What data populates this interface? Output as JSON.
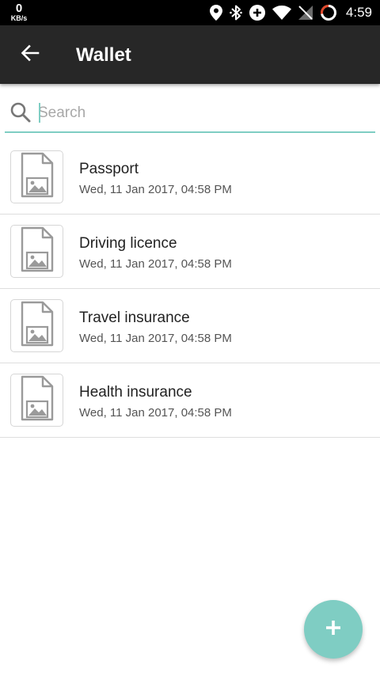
{
  "status_bar": {
    "net_speed_value": "0",
    "net_speed_unit": "KB/s",
    "time": "4:59",
    "icons": [
      "location-icon",
      "bluetooth-icon",
      "data-saver-icon",
      "wifi-icon",
      "no-signal-icon",
      "battery-icon"
    ]
  },
  "app_bar": {
    "title": "Wallet",
    "back_icon": "arrow-back-icon"
  },
  "search": {
    "placeholder": "Search",
    "value": "",
    "icon": "search-icon"
  },
  "documents": [
    {
      "title": "Passport",
      "date": "Wed, 11 Jan 2017, 04:58 PM",
      "icon": "image-file-icon"
    },
    {
      "title": "Driving licence",
      "date": "Wed, 11 Jan 2017, 04:58 PM",
      "icon": "image-file-icon"
    },
    {
      "title": "Travel insurance",
      "date": "Wed, 11 Jan 2017, 04:58 PM",
      "icon": "image-file-icon"
    },
    {
      "title": "Health insurance",
      "date": "Wed, 11 Jan 2017, 04:58 PM",
      "icon": "image-file-icon"
    }
  ],
  "fab": {
    "icon": "plus-icon"
  },
  "colors": {
    "accent": "#7fcdc3",
    "app_bar": "#272727",
    "status_bar": "#000000",
    "divider": "#dedede"
  }
}
